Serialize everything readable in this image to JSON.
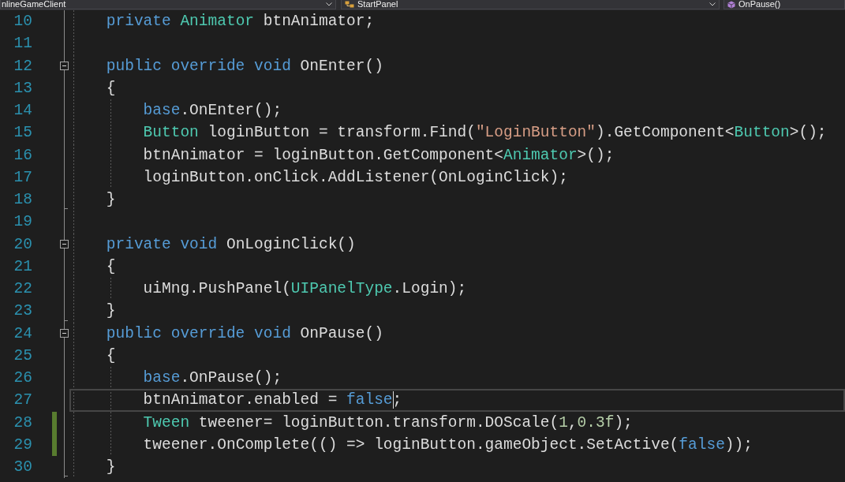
{
  "navigation_bar": {
    "project": "nlineGameClient",
    "type": "StartPanel",
    "member": "OnPause()"
  },
  "editor": {
    "lines": [
      {
        "number": "10",
        "kind": "code",
        "changed": false,
        "current": false,
        "tokens": [
          {
            "kind": "keyword",
            "text": "private"
          },
          {
            "kind": "type",
            "text": " Animator"
          },
          {
            "kind": "plain",
            "text": " btnAnimator;"
          }
        ]
      },
      {
        "number": "11",
        "changed": false,
        "current": false
      },
      {
        "number": "12",
        "kind": "block_start",
        "expanded": true,
        "changed": false,
        "current": false,
        "tokens": [
          {
            "kind": "keyword",
            "text": "public override void"
          },
          {
            "kind": "plain",
            "text": " OnEnter()"
          }
        ]
      },
      {
        "number": "13",
        "kind": "code",
        "changed": false,
        "current": false,
        "tokens": [
          {
            "kind": "plain",
            "text": "{"
          }
        ],
        "children": [
          {
            "number": "14",
            "kind": "code",
            "changed": false,
            "current": false,
            "tokens": [
              {
                "kind": "keyword",
                "text": "base"
              },
              {
                "kind": "plain",
                "text": ".OnEnter();"
              }
            ]
          },
          {
            "number": "15",
            "kind": "code",
            "changed": false,
            "current": false,
            "tokens": [
              {
                "kind": "type",
                "text": "Button"
              },
              {
                "kind": "plain",
                "text": " loginButton = transform.Find("
              },
              {
                "kind": "string",
                "text": "\"LoginButton\""
              },
              {
                "kind": "plain",
                "text": ").GetComponent<"
              },
              {
                "kind": "type",
                "text": "Button"
              },
              {
                "kind": "plain",
                "text": ">();"
              }
            ]
          },
          {
            "number": "16",
            "kind": "code",
            "changed": false,
            "current": false,
            "tokens": [
              {
                "kind": "plain",
                "text": "btnAnimator = loginButton.GetComponent<"
              },
              {
                "kind": "type",
                "text": "Animator"
              },
              {
                "kind": "plain",
                "text": ">();"
              }
            ]
          },
          {
            "number": "17",
            "kind": "code",
            "changed": false,
            "current": false,
            "tokens": [
              {
                "kind": "plain",
                "text": "loginButton.onClick.AddListener(OnLoginClick);"
              }
            ]
          }
        ]
      },
      {
        "number": "18",
        "kind": "block_end",
        "changed": false,
        "current": false,
        "tokens": [
          {
            "kind": "plain",
            "text": "}"
          }
        ]
      },
      {
        "number": "19",
        "changed": false,
        "current": false
      },
      {
        "number": "20",
        "kind": "block_start",
        "expanded": true,
        "changed": false,
        "current": false,
        "tokens": [
          {
            "kind": "keyword",
            "text": "private void"
          },
          {
            "kind": "plain",
            "text": " OnLoginClick()"
          }
        ]
      },
      {
        "number": "21",
        "kind": "code",
        "changed": false,
        "current": false,
        "tokens": [
          {
            "kind": "plain",
            "text": "{"
          }
        ],
        "children": [
          {
            "number": "22",
            "kind": "code",
            "changed": false,
            "current": false,
            "tokens": [
              {
                "kind": "plain",
                "text": "uiMng.PushPanel("
              },
              {
                "kind": "type",
                "text": "UIPanelType"
              },
              {
                "kind": "plain",
                "text": ".Login);"
              }
            ]
          }
        ]
      },
      {
        "number": "23",
        "kind": "block_end",
        "changed": false,
        "current": false,
        "tokens": [
          {
            "kind": "plain",
            "text": "}"
          }
        ]
      },
      {
        "number": "24",
        "kind": "block_start",
        "expanded": true,
        "changed": false,
        "current": false,
        "tokens": [
          {
            "kind": "keyword",
            "text": "public override void"
          },
          {
            "kind": "plain",
            "text": " OnPause()"
          }
        ]
      },
      {
        "number": "25",
        "kind": "code",
        "changed": false,
        "current": false,
        "tokens": [
          {
            "kind": "plain",
            "text": "{"
          }
        ],
        "children": [
          {
            "number": "26",
            "kind": "code",
            "changed": false,
            "current": false,
            "tokens": [
              {
                "kind": "keyword",
                "text": "base"
              },
              {
                "kind": "plain",
                "text": ".OnPause();"
              }
            ]
          },
          {
            "number": "27",
            "kind": "code",
            "changed": false,
            "current": true,
            "tokens": [
              {
                "kind": "plain",
                "text": "btnAnimator.enabled = "
              },
              {
                "kind": "keyword",
                "text": "false",
                "caret": true
              },
              {
                "kind": "plain",
                "text": ";"
              }
            ]
          },
          {
            "number": "28",
            "kind": "code",
            "changed": true,
            "current": false,
            "tokens": [
              {
                "kind": "type",
                "text": "Tween"
              },
              {
                "kind": "plain",
                "text": " tweener= loginButton.transform.DOScale("
              },
              {
                "kind": "number",
                "text": "1"
              },
              {
                "kind": "plain",
                "text": ","
              },
              {
                "kind": "number",
                "text": "0.3f"
              },
              {
                "kind": "plain",
                "text": ");"
              }
            ]
          },
          {
            "number": "29",
            "kind": "code",
            "changed": true,
            "current": false,
            "tokens": [
              {
                "kind": "plain",
                "text": "tweener.OnComplete(() => loginButton.gameObject.SetActive("
              },
              {
                "kind": "keyword",
                "text": "false"
              },
              {
                "kind": "plain",
                "text": "));"
              }
            ]
          }
        ]
      },
      {
        "number": "30",
        "kind": "block_end",
        "changed": false,
        "current": false,
        "tokens": [
          {
            "kind": "plain",
            "text": "}"
          }
        ]
      }
    ]
  }
}
